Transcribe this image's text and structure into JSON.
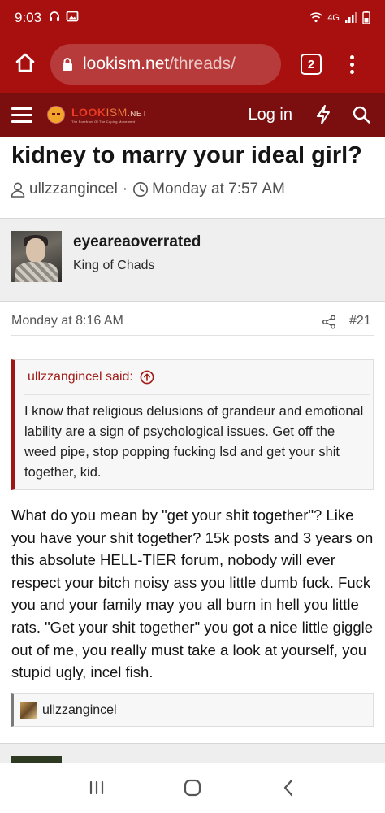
{
  "status_bar": {
    "time": "9:03",
    "network": "4G",
    "icons": [
      "headset-icon",
      "image-icon",
      "wifi-icon",
      "signal-icon",
      "battery-icon"
    ]
  },
  "browser": {
    "url_domain": "lookism.net",
    "url_path": "/threads/",
    "tab_count": "2",
    "icons": [
      "home-icon",
      "lock-icon",
      "menu-dots-icon"
    ]
  },
  "site_header": {
    "logo_parts": [
      "LOOK",
      "ISM",
      ".NET"
    ],
    "logo_tagline": "The Forefront Of The Coping Movement",
    "login_label": "Log in",
    "icons": [
      "hamburger-icon",
      "logo-face-icon",
      "bolt-icon",
      "search-icon"
    ]
  },
  "thread": {
    "title": "kidney to marry your ideal girl?",
    "author": "ullzzangincel",
    "separator": "·",
    "date": "Monday at 7:57 AM"
  },
  "post": {
    "username": "eyeareaoverrated",
    "user_title": "King of Chads",
    "date": "Monday at 8:16 AM",
    "post_number": "#21",
    "quote": {
      "author_said": "ullzzangincel said:",
      "text": "I know that religious delusions of grandeur and emotional lability are a sign of psychological issues. Get off the weed pipe, stop popping fucking lsd and get your shit together, kid."
    },
    "message": "What do you mean by \"get your shit together\"? Like you have your shit together? 15k posts and 3 years on this absolute HELL-TIER forum, nobody will ever respect your bitch noisy ass you little dumb fuck. Fuck you and your family may you all burn in hell you little rats. \"Get your shit together\" you got a nice little giggle out of me, you really must take a look at yourself, you stupid ugly, incel fish.",
    "reaction_user": "ullzzangincel"
  },
  "colors": {
    "browser_red": "#a8100f",
    "header_red": "#7b0f0f",
    "quote_accent": "#9e1712"
  },
  "nav": {
    "icons": [
      "recent-apps-icon",
      "home-nav-icon",
      "back-icon"
    ]
  }
}
